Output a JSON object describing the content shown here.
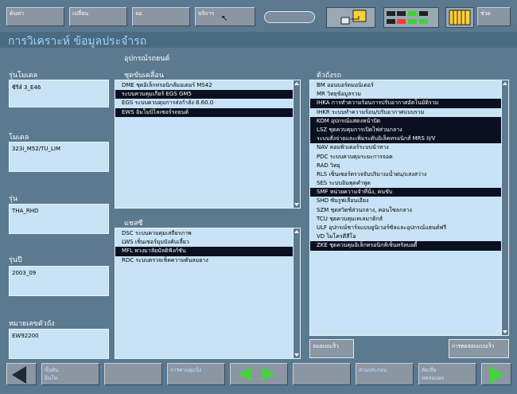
{
  "toolbar": {
    "btn1": "ค้นหา",
    "btn2": "เปลี่ยน",
    "btn3": "จอ",
    "btn4": "บริการ",
    "help": "ช่วย"
  },
  "title": "การวิเคราะห์  ข้อมูลประจำรถ",
  "section_vehicle_equipment": "อุปกรณ์รถยนต์",
  "left": {
    "series_label": "รุ่นโมเดล",
    "series_value": "ซีรีส์ 3_E46",
    "model_label": "โมเดล",
    "model_value": "323i_M52/TU_LIM",
    "version_label": "รุ่น",
    "version_value": "THA_RHD",
    "year_label": "รุ่นปี",
    "year_value": "2003_09",
    "chassis_label": "หมายเลขตัวถัง",
    "chassis_value": "EW92200"
  },
  "drivetrain": {
    "header": "ชุดขับเคลื่อน",
    "items": [
      {
        "label": "DME ชุดอิเล็กทรอนิกส์มอเตอร์ MS42",
        "selected": false
      },
      {
        "label": "ระบบควบคุมเกียร์ EGS GM5",
        "selected": true
      },
      {
        "label": "EGS ระบบควบคุมการส่งกำลัง 8.60.0",
        "selected": false
      },
      {
        "label": "EWS อิมโมบิไลเซอร์รถยนต์",
        "selected": true
      }
    ]
  },
  "chassis": {
    "header": "แชสซี",
    "items": [
      {
        "label": "DSC ระบบควบคุมเสถียรภาพ",
        "selected": false
      },
      {
        "label": "LWS เซ็นเซอร์มุมบังคับเลี้ยว",
        "selected": false
      },
      {
        "label": "MFL พวงมาลัยมัลติฟังก์ชัน",
        "selected": true
      },
      {
        "label": "RDC ระบบตรวจเช็คความดันลมยาง",
        "selected": false
      }
    ]
  },
  "body": {
    "header": "ตัวถังรถ",
    "items": [
      {
        "label": "BM ออนบอร์ดมอนิเตอร์",
        "selected": false
      },
      {
        "label": "MR วิทยุข้อมูลรวม",
        "selected": false
      },
      {
        "label": "IHKA การทำความร้อนการปรับอากาศอัตโนมัติรวม",
        "selected": true
      },
      {
        "label": "IHKR ระบบทำความร้อน/ปรับอากาศแบบรวม",
        "selected": false
      },
      {
        "label": "KOM อุปกรณ์แสดงหน้าปัด",
        "selected": true
      },
      {
        "label": "LSZ ชุดควบคุมการเปิดไฟส่วนกลาง",
        "selected": true
      },
      {
        "label": "ระบบสั่งจ่ายและเพิ่มระดับอิเล็คทรอนิกส์ MRS II/V",
        "selected": true
      },
      {
        "label": "NAV คอมพิวเตอร์ระบบนำทาง",
        "selected": false
      },
      {
        "label": "PDC ระบบควบคุมระยะการจอด",
        "selected": false
      },
      {
        "label": "RAD วิทยุ",
        "selected": false
      },
      {
        "label": "RLS เซ็นเซอร์ตรวจจับปริมาณน้ำฝน/แสงสว่าง",
        "selected": false
      },
      {
        "label": "SES ระบบอินพุตคำพูด",
        "selected": false
      },
      {
        "label": "SMF หน่วยความจำที่นั่ง, คนขับ",
        "selected": true
      },
      {
        "label": "SHD ซันรูฟเลื่อนเอียง",
        "selected": false
      },
      {
        "label": "SZM ชุดสวิตช์ส่วนกลาง, คอนโซลกลาง",
        "selected": false
      },
      {
        "label": "TCU ชุดควบคุมเทเลมาติกส์",
        "selected": false
      },
      {
        "label": "ULF อุปกรณ์ชาร์จแบบยูนิเวอร์ซัลและอุปกรณ์แฮนด์ฟรี",
        "selected": false
      },
      {
        "label": "VD ไมโครดีสีโอ",
        "selected": false
      },
      {
        "label": "ZKE ชุดควบคุมอิเล็กทรอนิกส์เซ็นทรัลบอดี้",
        "selected": true
      }
    ],
    "btn_left": "ลองแบบเร็ว",
    "btn_right": "การทดสอบแบบเร็ว"
  },
  "bottom": {
    "b1": "ขั้นต้น\nอินโพ",
    "b2": "",
    "b3": "การควบคุมนิ่ง",
    "b4": "",
    "b5": "",
    "b6": "ส่วนประกอบ",
    "b7": "ตัดเสีย\nทดสอบผล"
  }
}
